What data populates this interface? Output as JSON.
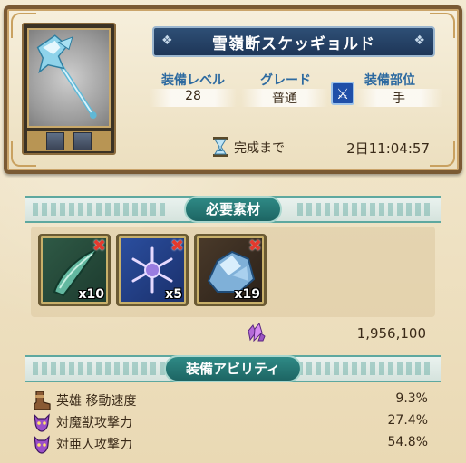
{
  "equipment": {
    "name": "雪嶺断スケッギョルド",
    "level_label": "装備レベル",
    "level_value": "28",
    "grade_label": "グレード",
    "grade_value": "普通",
    "slot_label": "装備部位",
    "slot_value": "手",
    "slot_icon": "sword-icon",
    "timer_label": "完成まで",
    "timer_value": "2日11:04:57"
  },
  "materials": {
    "header": "必要素材",
    "items": [
      {
        "icon": "green-fang-icon",
        "quantity": "x10",
        "missing": true
      },
      {
        "icon": "snowflake-crystal-icon",
        "quantity": "x5",
        "missing": true
      },
      {
        "icon": "ice-ore-icon",
        "quantity": "x19",
        "missing": true
      }
    ],
    "cost_icon": "purple-crystal-icon",
    "cost_value": "1,956,100"
  },
  "abilities": {
    "header": "装備アビリティ",
    "items": [
      {
        "icon": "boot-icon",
        "label": "英雄 移動速度",
        "value": "9.3%"
      },
      {
        "icon": "purple-demon-icon",
        "label": "対魔獣攻撃力",
        "value": "27.4%"
      },
      {
        "icon": "purple-demon-icon",
        "label": "対亜人攻撃力",
        "value": "54.8%"
      }
    ]
  },
  "colors": {
    "banner": "#1e3658",
    "section_pill": "#1d6563",
    "label_blue": "#2d6aa0",
    "missing_red": "#e43a2e"
  }
}
